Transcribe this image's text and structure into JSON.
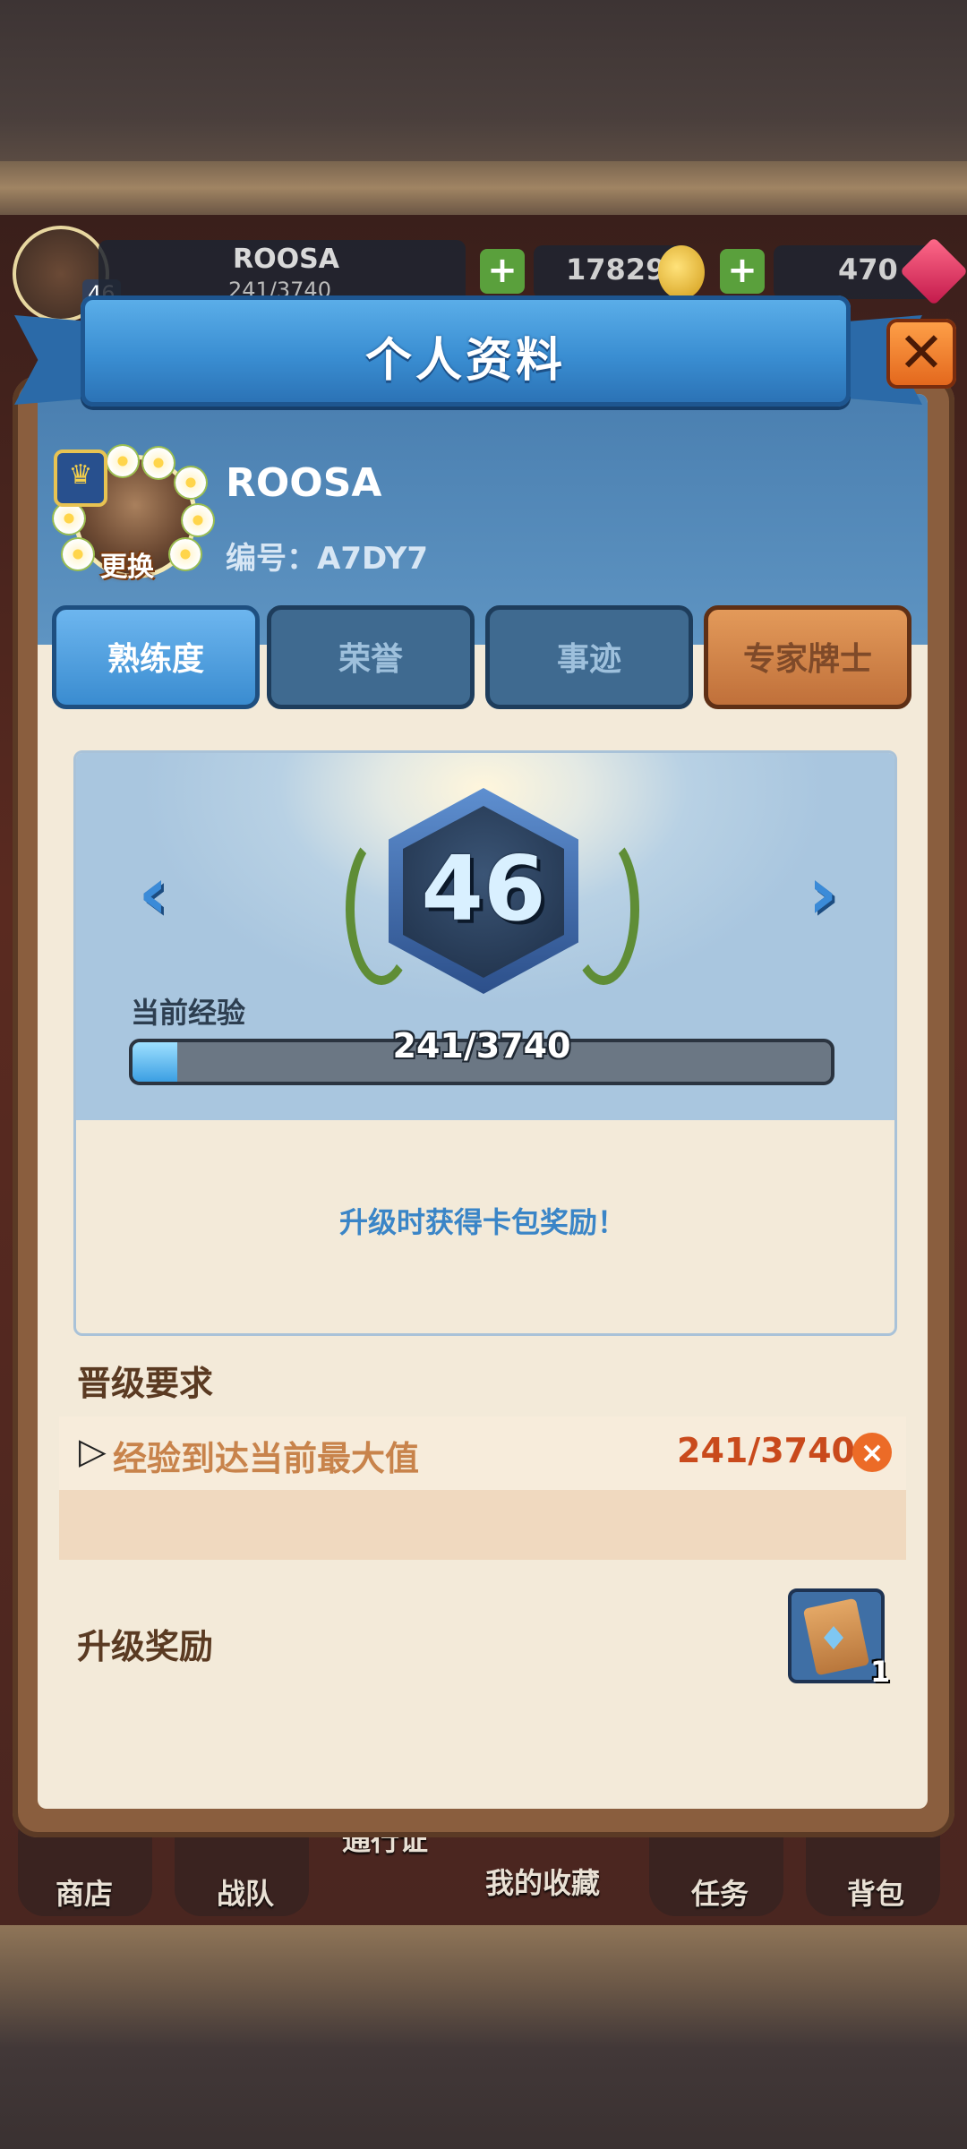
{
  "topbar": {
    "level": "46",
    "name": "ROOSA",
    "exp": "241/3740",
    "coins": "17829",
    "gems": "470"
  },
  "dialog": {
    "title": "个人资料",
    "close_icon": "close-x",
    "player": {
      "name": "ROOSA",
      "id": "编号：A7DY7",
      "change_label": "更换"
    },
    "tabs": [
      {
        "label": "熟练度",
        "state": "active"
      },
      {
        "label": "荣誉",
        "state": "inactive"
      },
      {
        "label": "事迹",
        "state": "inactive"
      },
      {
        "label": "专家牌士",
        "state": "special"
      }
    ],
    "level_panel": {
      "level": "46",
      "exp_label": "当前经验",
      "exp_text": "241/3740",
      "exp_fraction": 0.0644,
      "reward_note": "升级时获得卡包奖励！"
    },
    "requirements": {
      "title": "晋级要求",
      "items": [
        {
          "text": "经验到达当前最大值",
          "value": "241/3740",
          "status_icon": "cross-icon"
        }
      ]
    },
    "rewards": {
      "title": "升级奖励",
      "items": [
        {
          "icon": "card-pack-icon",
          "count": "1"
        }
      ]
    }
  },
  "bottom_nav": {
    "items": [
      "商店",
      "战队",
      "通行证",
      "我的收藏",
      "任务",
      "背包"
    ]
  },
  "colors": {
    "accent_blue": "#3a8ed2",
    "close_orange": "#e2651b",
    "requirement_value": "#c94a1c"
  }
}
